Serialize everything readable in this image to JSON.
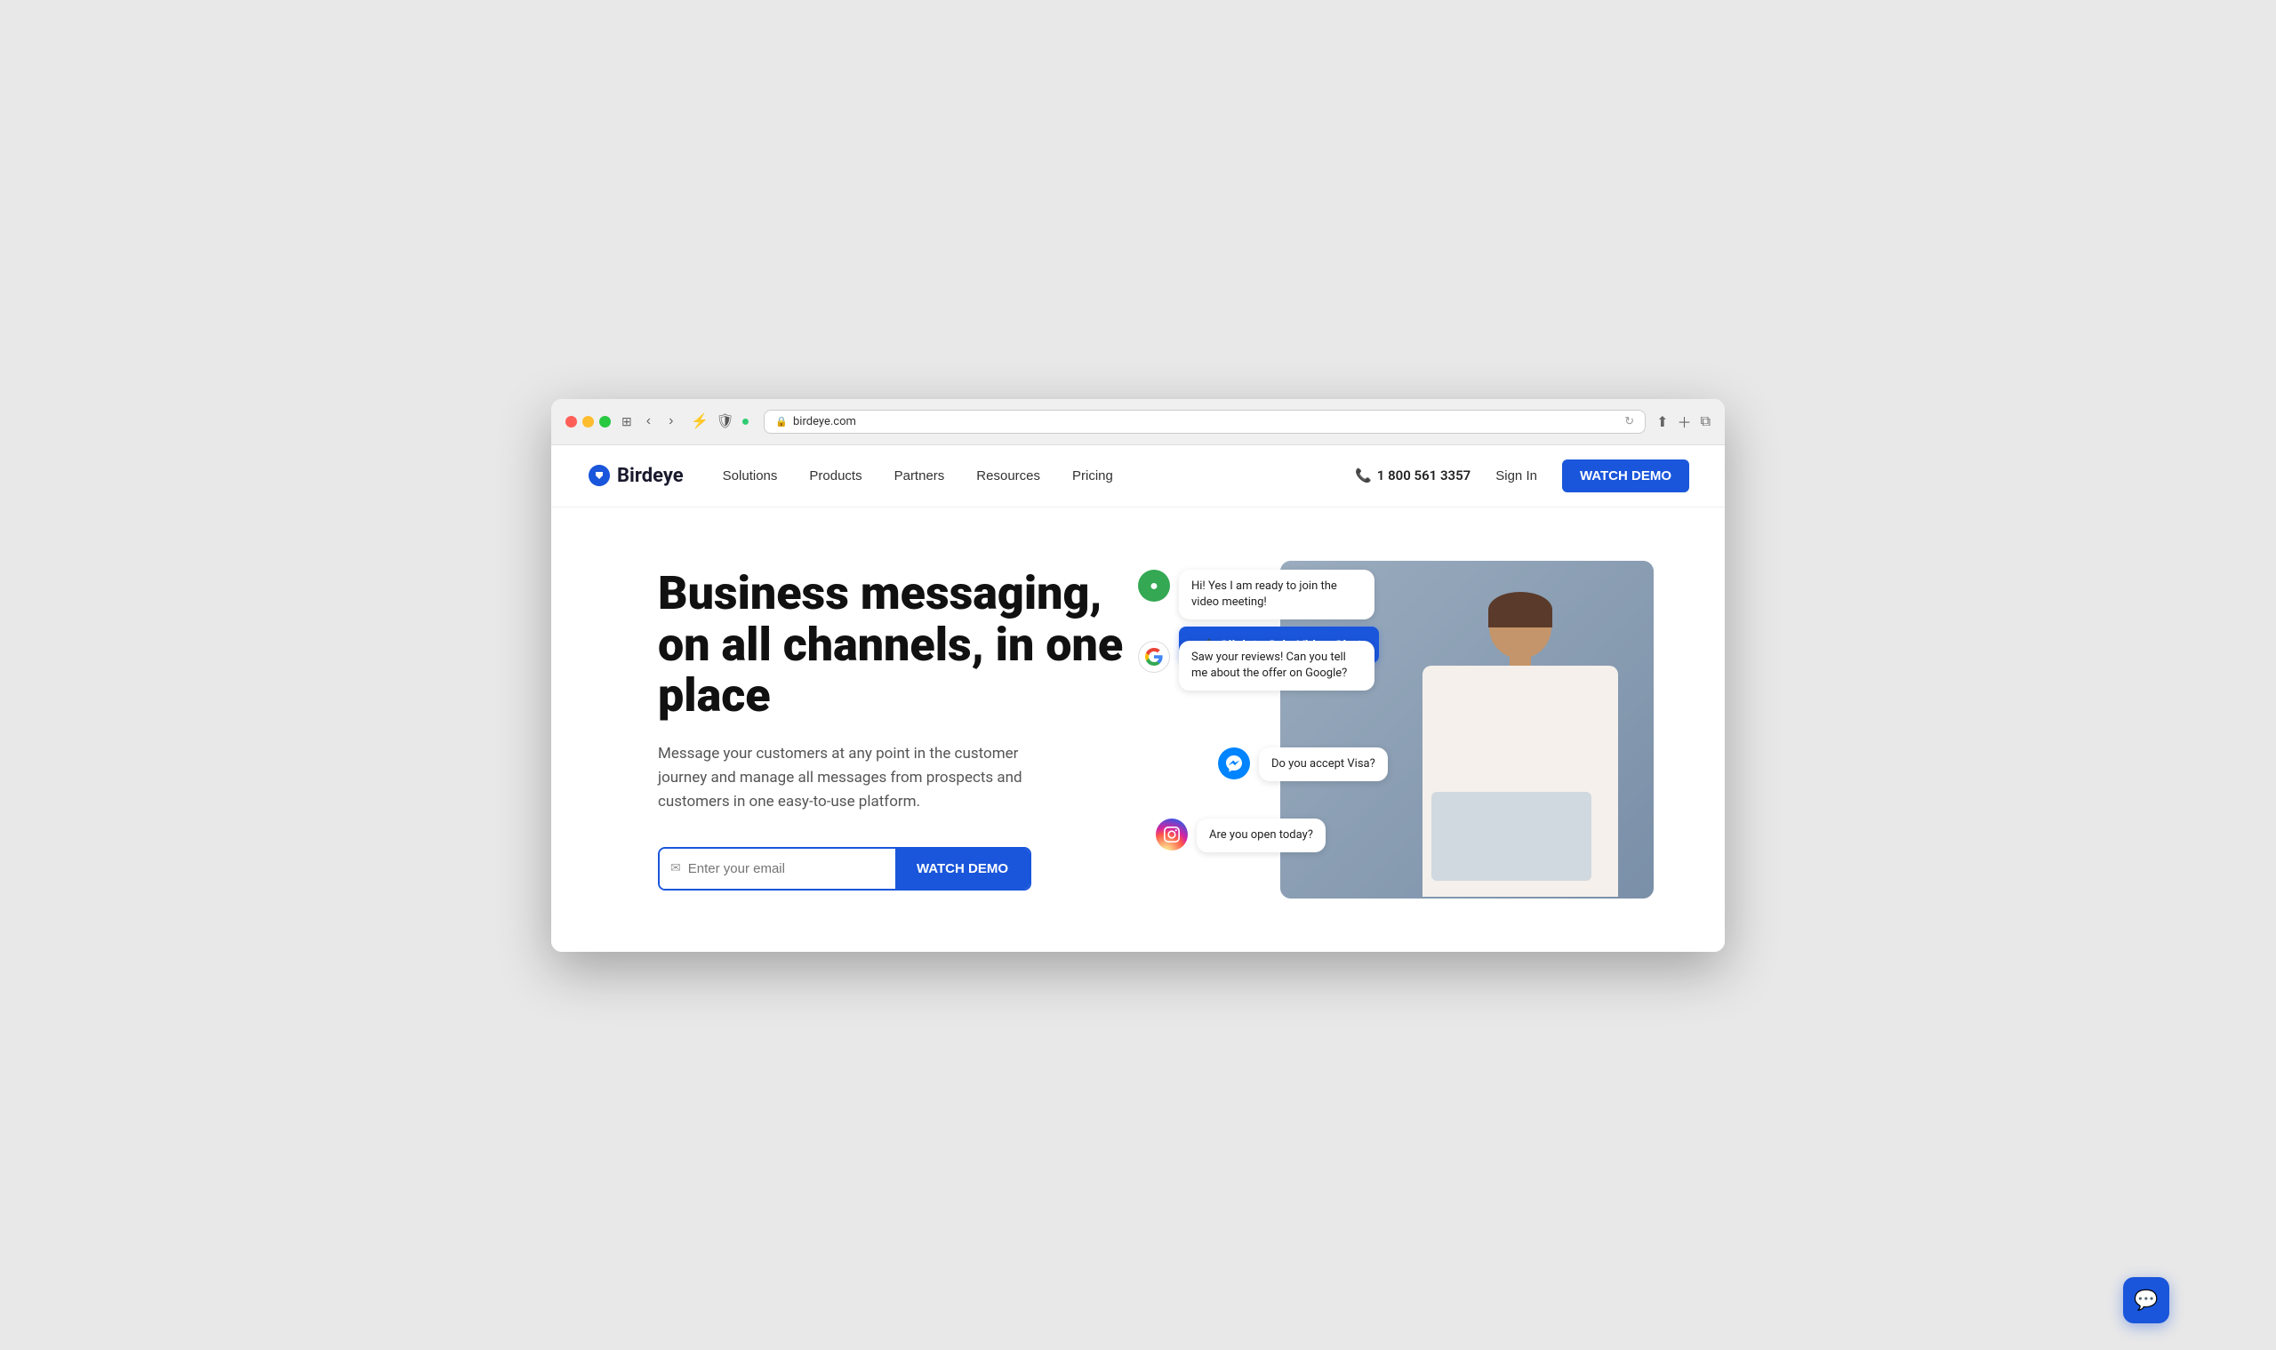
{
  "browser": {
    "url": "birdeye.com",
    "back_label": "‹",
    "forward_label": "›"
  },
  "nav": {
    "logo_text": "Birdeye",
    "links": [
      {
        "label": "Solutions",
        "id": "solutions"
      },
      {
        "label": "Products",
        "id": "products"
      },
      {
        "label": "Partners",
        "id": "partners"
      },
      {
        "label": "Resources",
        "id": "resources"
      },
      {
        "label": "Pricing",
        "id": "pricing"
      }
    ],
    "phone": "1 800 561 3357",
    "sign_in": "Sign In",
    "watch_demo": "WATCH DEMO"
  },
  "hero": {
    "title": "Business messaging, on all channels, in one place",
    "subtitle": "Message your customers at any point in the customer journey and manage all messages from prospects and customers in one easy-to-use platform.",
    "email_placeholder": "Enter your email",
    "cta_button": "WATCH DEMO"
  },
  "chat_bubbles": [
    {
      "id": "bubble1",
      "icon_type": "green-dot",
      "text": "Hi! Yes I am ready to join the video meeting!",
      "has_video_btn": true,
      "video_btn_text": "Click to Join Video Chat"
    },
    {
      "id": "bubble2",
      "icon_type": "google",
      "text": "Saw your reviews! Can you tell me about the offer on Google?"
    },
    {
      "id": "bubble3",
      "icon_type": "messenger",
      "text": "Do you accept Visa?"
    },
    {
      "id": "bubble4",
      "icon_type": "instagram",
      "text": "Are you open today?"
    }
  ],
  "chat_widget": {
    "label": "Chat"
  }
}
